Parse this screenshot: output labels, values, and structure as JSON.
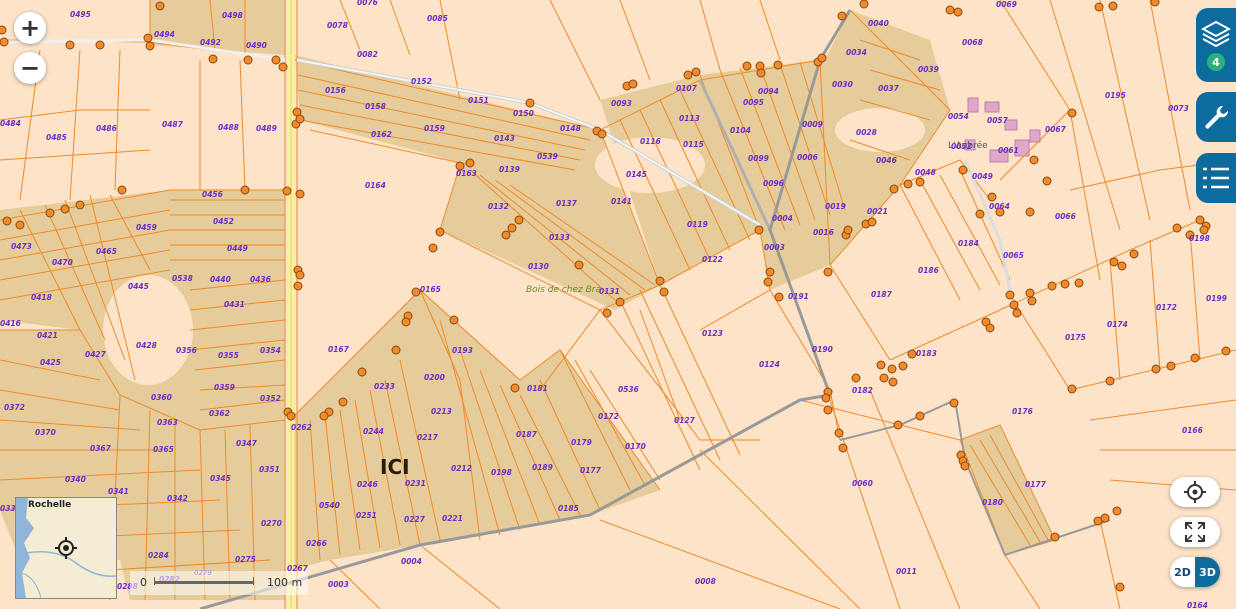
{
  "map": {
    "marker_label": "ICI",
    "woods_label": "Bois de chez Bra",
    "locality_label": "L'Aubrée",
    "parcels": [
      {
        "id": "0495"
      },
      {
        "id": "0498"
      },
      {
        "id": "0076"
      },
      {
        "id": "0085"
      },
      {
        "id": "0069"
      },
      {
        "id": "0494"
      },
      {
        "id": "0492"
      },
      {
        "id": "0490"
      },
      {
        "id": "0078"
      },
      {
        "id": "0082"
      },
      {
        "id": "0040"
      },
      {
        "id": "0068"
      },
      {
        "id": "0039"
      },
      {
        "id": "0034"
      },
      {
        "id": "0030"
      },
      {
        "id": "0037"
      },
      {
        "id": "0195"
      },
      {
        "id": "0073"
      },
      {
        "id": "0484"
      },
      {
        "id": "0485"
      },
      {
        "id": "0486"
      },
      {
        "id": "0487"
      },
      {
        "id": "0488"
      },
      {
        "id": "0489"
      },
      {
        "id": "0156"
      },
      {
        "id": "0158"
      },
      {
        "id": "0152"
      },
      {
        "id": "0151"
      },
      {
        "id": "0150"
      },
      {
        "id": "0093"
      },
      {
        "id": "0107"
      },
      {
        "id": "0095"
      },
      {
        "id": "0094"
      },
      {
        "id": "0113"
      },
      {
        "id": "0104"
      },
      {
        "id": "0009"
      },
      {
        "id": "0028"
      },
      {
        "id": "0054"
      },
      {
        "id": "0057"
      },
      {
        "id": "0067"
      },
      {
        "id": "0052"
      },
      {
        "id": "0061"
      },
      {
        "id": "0162"
      },
      {
        "id": "0159"
      },
      {
        "id": "0143"
      },
      {
        "id": "0148"
      },
      {
        "id": "0116"
      },
      {
        "id": "0115"
      },
      {
        "id": "0099"
      },
      {
        "id": "0006"
      },
      {
        "id": "0046"
      },
      {
        "id": "0048"
      },
      {
        "id": "0049"
      },
      {
        "id": "0539"
      },
      {
        "id": "0163"
      },
      {
        "id": "0139"
      },
      {
        "id": "0145"
      },
      {
        "id": "0096"
      },
      {
        "id": "0164"
      },
      {
        "id": "0456"
      },
      {
        "id": "0137"
      },
      {
        "id": "0141"
      },
      {
        "id": "0019"
      },
      {
        "id": "0064"
      },
      {
        "id": "0132"
      },
      {
        "id": "0021"
      },
      {
        "id": "0066"
      },
      {
        "id": "0459"
      },
      {
        "id": "0452"
      },
      {
        "id": "0119"
      },
      {
        "id": "0004"
      },
      {
        "id": "0016"
      },
      {
        "id": "0198"
      },
      {
        "id": "0133"
      },
      {
        "id": "0473"
      },
      {
        "id": "0449"
      },
      {
        "id": "0003"
      },
      {
        "id": "0184"
      },
      {
        "id": "0470"
      },
      {
        "id": "0465"
      },
      {
        "id": "0130"
      },
      {
        "id": "0122"
      },
      {
        "id": "0065"
      },
      {
        "id": "0186"
      },
      {
        "id": "0538"
      },
      {
        "id": "0440"
      },
      {
        "id": "0436"
      },
      {
        "id": "0445"
      },
      {
        "id": "0165"
      },
      {
        "id": "0131"
      },
      {
        "id": "0418"
      },
      {
        "id": "0431"
      },
      {
        "id": "0191"
      },
      {
        "id": "0187"
      },
      {
        "id": "0172"
      },
      {
        "id": "0199"
      },
      {
        "id": "0416"
      },
      {
        "id": "0421"
      },
      {
        "id": "0174"
      },
      {
        "id": "0123"
      },
      {
        "id": "0175"
      },
      {
        "id": "0428"
      },
      {
        "id": "0356"
      },
      {
        "id": "0354"
      },
      {
        "id": "0167"
      },
      {
        "id": "0193"
      },
      {
        "id": "0190"
      },
      {
        "id": "0183"
      },
      {
        "id": "0427"
      },
      {
        "id": "0355"
      },
      {
        "id": "0425"
      },
      {
        "id": "0124"
      },
      {
        "id": "0200"
      },
      {
        "id": "0233"
      },
      {
        "id": "0181"
      },
      {
        "id": "0536"
      },
      {
        "id": "0359"
      },
      {
        "id": "0182"
      },
      {
        "id": "0372"
      },
      {
        "id": "0360"
      },
      {
        "id": "0352"
      },
      {
        "id": "0362"
      },
      {
        "id": "0213"
      },
      {
        "id": "0172"
      },
      {
        "id": "0127"
      },
      {
        "id": "0176"
      },
      {
        "id": "0363"
      },
      {
        "id": "0262"
      },
      {
        "id": "0244"
      },
      {
        "id": "0370"
      },
      {
        "id": "0347"
      },
      {
        "id": "0217"
      },
      {
        "id": "0187"
      },
      {
        "id": "0179"
      },
      {
        "id": "0170"
      },
      {
        "id": "0166"
      },
      {
        "id": "0367"
      },
      {
        "id": "0365"
      },
      {
        "id": "0212"
      },
      {
        "id": "0198"
      },
      {
        "id": "0189"
      },
      {
        "id": "0177"
      },
      {
        "id": "0351"
      },
      {
        "id": "0345"
      },
      {
        "id": "0340"
      },
      {
        "id": "0231"
      },
      {
        "id": "0246"
      },
      {
        "id": "0060"
      },
      {
        "id": "0177"
      },
      {
        "id": "0341"
      },
      {
        "id": "0342"
      },
      {
        "id": "0540"
      },
      {
        "id": "0185"
      },
      {
        "id": "0180"
      },
      {
        "id": "0333"
      },
      {
        "id": "0251"
      },
      {
        "id": "0227"
      },
      {
        "id": "0221"
      },
      {
        "id": "0270"
      },
      {
        "id": "0266"
      },
      {
        "id": "0284"
      },
      {
        "id": "0275"
      },
      {
        "id": "0004"
      },
      {
        "id": "0011"
      },
      {
        "id": "0288"
      },
      {
        "id": "0282"
      },
      {
        "id": "0267"
      },
      {
        "id": "0003"
      },
      {
        "id": "0008"
      },
      {
        "id": "0164"
      }
    ]
  },
  "controls": {
    "zoom_in": "+",
    "zoom_out": "−",
    "layers_badge": "4",
    "view_2d": "2D",
    "view_3d": "3D"
  },
  "minimap": {
    "label": "Rochelle"
  },
  "scale": {
    "min": "0",
    "max": "100 m",
    "faint": "0279"
  }
}
